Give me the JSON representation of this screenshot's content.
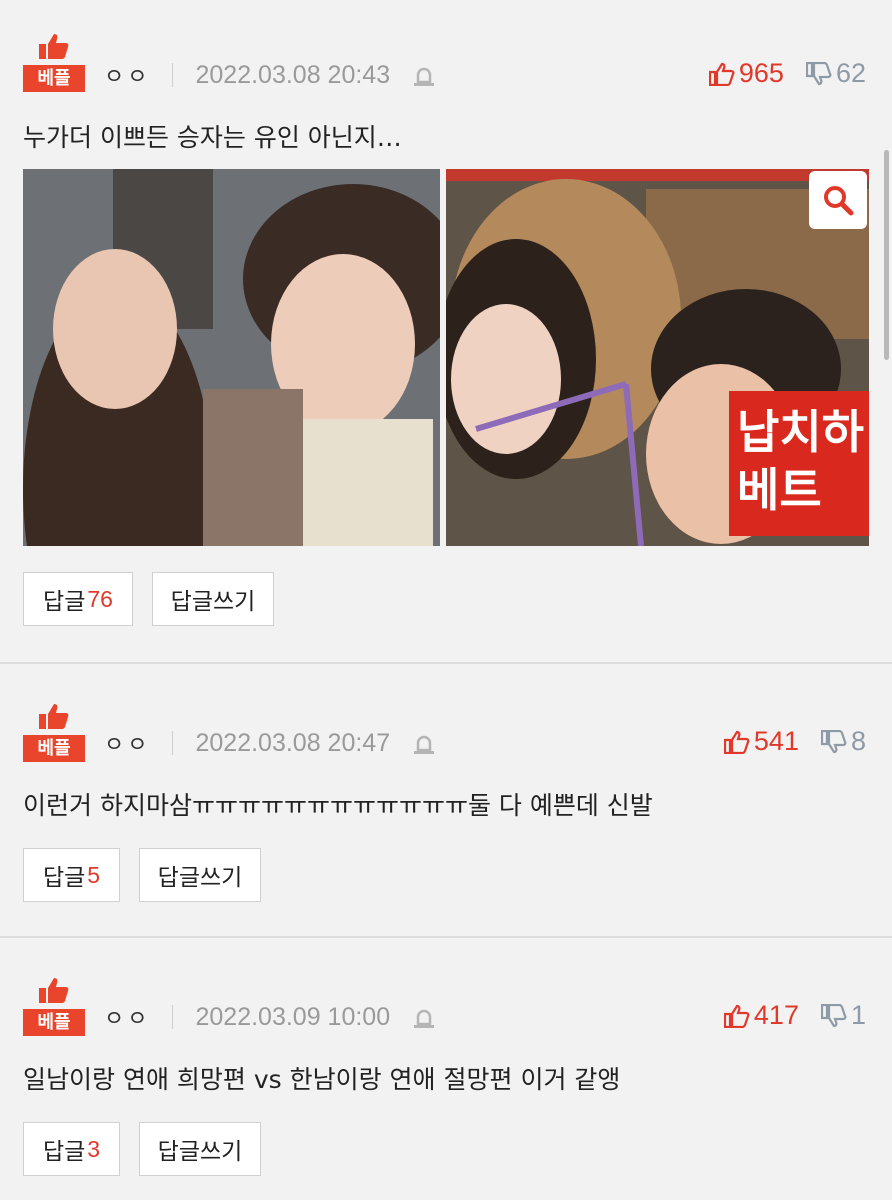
{
  "badge": {
    "label": "베플"
  },
  "comments": [
    {
      "nickname": "ㅇㅇ",
      "date": "2022.03.08 20:43",
      "likes": "965",
      "dislikes": "62",
      "text": "누가더 이쁘든 승자는 유인 아닌지…",
      "reply_label": "답글",
      "reply_count": "76",
      "write_reply_label": "답글쓰기",
      "image_overlay_text": "납치하\n베트"
    },
    {
      "nickname": "ㅇㅇ",
      "date": "2022.03.08 20:47",
      "likes": "541",
      "dislikes": "8",
      "text": "이런거 하지마삼ㅠㅠㅠㅠㅠㅠㅠㅠㅠㅠㅠㅠ둘 다 예쁜데 신발",
      "reply_label": "답글",
      "reply_count": "5",
      "write_reply_label": "답글쓰기"
    },
    {
      "nickname": "ㅇㅇ",
      "date": "2022.03.09 10:00",
      "likes": "417",
      "dislikes": "1",
      "text": "일남이랑 연애 희망편 vs 한남이랑 연애 절망편 이거 같앵",
      "reply_label": "답글",
      "reply_count": "3",
      "write_reply_label": "답글쓰기"
    }
  ],
  "colors": {
    "accent": "#e8452c",
    "like": "#e0392b",
    "dislike": "#8e9aa6",
    "background": "#f2f2f2"
  }
}
